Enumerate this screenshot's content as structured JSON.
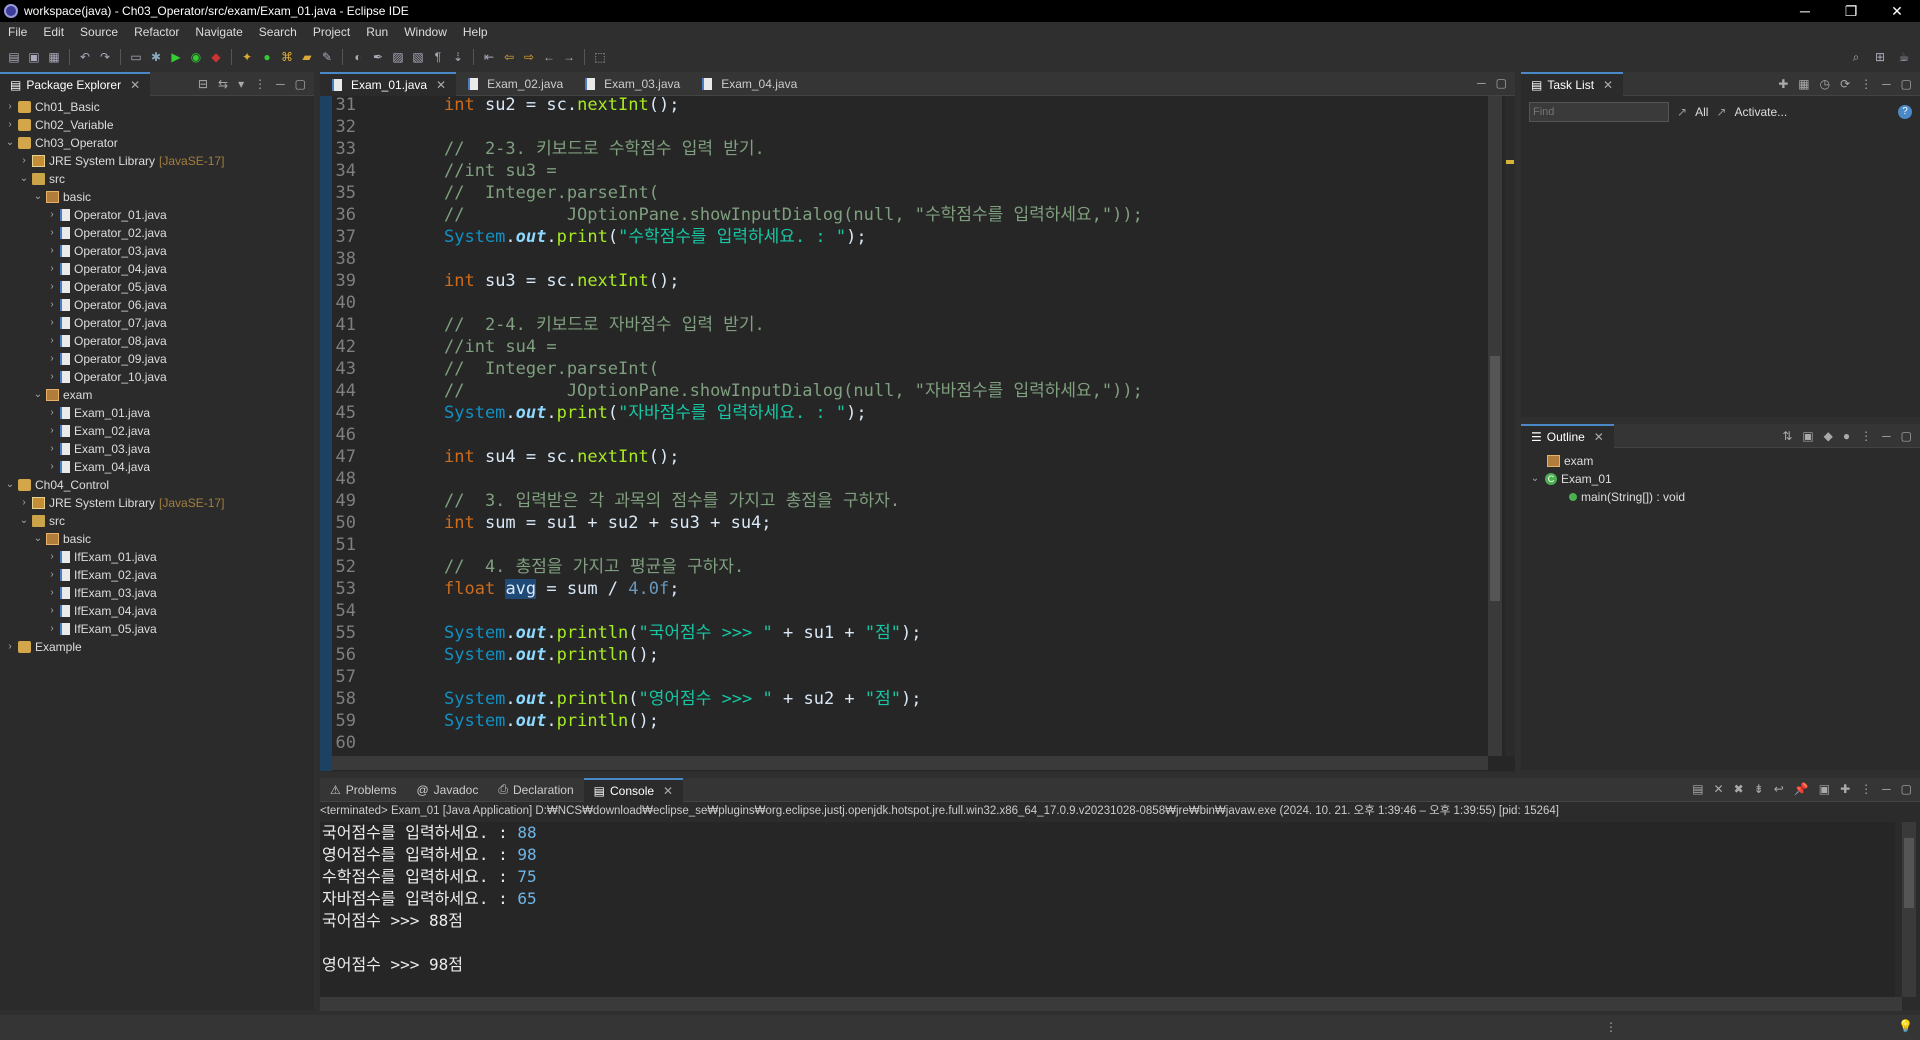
{
  "window": {
    "title": "workspace(java) - Ch03_Operator/src/exam/Exam_01.java - Eclipse IDE"
  },
  "menu": [
    "File",
    "Edit",
    "Source",
    "Refactor",
    "Navigate",
    "Search",
    "Project",
    "Run",
    "Window",
    "Help"
  ],
  "package_explorer": {
    "title": "Package Explorer",
    "items": [
      {
        "label": "Ch01_Basic",
        "type": "proj",
        "level": 0,
        "open": false
      },
      {
        "label": "Ch02_Variable",
        "type": "proj",
        "level": 0,
        "open": false
      },
      {
        "label": "Ch03_Operator",
        "type": "proj",
        "level": 0,
        "open": true
      },
      {
        "label": "JRE System Library",
        "extra": "[JavaSE-17]",
        "type": "lib",
        "level": 1,
        "open": false
      },
      {
        "label": "src",
        "type": "src",
        "level": 1,
        "open": true
      },
      {
        "label": "basic",
        "type": "pkg",
        "level": 2,
        "open": true
      },
      {
        "label": "Operator_01.java",
        "type": "java",
        "level": 3,
        "open": false
      },
      {
        "label": "Operator_02.java",
        "type": "java",
        "level": 3,
        "open": false
      },
      {
        "label": "Operator_03.java",
        "type": "java",
        "level": 3,
        "open": false
      },
      {
        "label": "Operator_04.java",
        "type": "java",
        "level": 3,
        "open": false
      },
      {
        "label": "Operator_05.java",
        "type": "java",
        "level": 3,
        "open": false
      },
      {
        "label": "Operator_06.java",
        "type": "java",
        "level": 3,
        "open": false
      },
      {
        "label": "Operator_07.java",
        "type": "java",
        "level": 3,
        "open": false
      },
      {
        "label": "Operator_08.java",
        "type": "java",
        "level": 3,
        "open": false
      },
      {
        "label": "Operator_09.java",
        "type": "java",
        "level": 3,
        "open": false
      },
      {
        "label": "Operator_10.java",
        "type": "java",
        "level": 3,
        "open": false
      },
      {
        "label": "exam",
        "type": "pkg",
        "level": 2,
        "open": true
      },
      {
        "label": "Exam_01.java",
        "type": "java",
        "level": 3,
        "open": false
      },
      {
        "label": "Exam_02.java",
        "type": "java",
        "level": 3,
        "open": false
      },
      {
        "label": "Exam_03.java",
        "type": "java",
        "level": 3,
        "open": false
      },
      {
        "label": "Exam_04.java",
        "type": "java",
        "level": 3,
        "open": false
      },
      {
        "label": "Ch04_Control",
        "type": "proj",
        "level": 0,
        "open": true
      },
      {
        "label": "JRE System Library",
        "extra": "[JavaSE-17]",
        "type": "lib",
        "level": 1,
        "open": false
      },
      {
        "label": "src",
        "type": "src",
        "level": 1,
        "open": true
      },
      {
        "label": "basic",
        "type": "pkg",
        "level": 2,
        "open": true
      },
      {
        "label": "IfExam_01.java",
        "type": "java",
        "level": 3,
        "open": false
      },
      {
        "label": "IfExam_02.java",
        "type": "java",
        "level": 3,
        "open": false
      },
      {
        "label": "IfExam_03.java",
        "type": "java",
        "level": 3,
        "open": false
      },
      {
        "label": "IfExam_04.java",
        "type": "java",
        "level": 3,
        "open": false
      },
      {
        "label": "IfExam_05.java",
        "type": "java",
        "level": 3,
        "open": false
      },
      {
        "label": "Example",
        "type": "proj",
        "level": 0,
        "open": false
      }
    ]
  },
  "editor": {
    "tabs": [
      "Exam_01.java",
      "Exam_02.java",
      "Exam_03.java",
      "Exam_04.java"
    ],
    "lines": [
      {
        "n": "31",
        "html": "<span class='kw'>int</span> su2 = sc.<span class='mth'>nextInt</span>();"
      },
      {
        "n": "32",
        "html": ""
      },
      {
        "n": "33",
        "html": "<span class='cm'>//  2-3. 키보드로 수학점수 입력 받기.</span>"
      },
      {
        "n": "34",
        "html": "<span class='cm'>//int su3 =</span>"
      },
      {
        "n": "35",
        "html": "<span class='cm'>//  Integer.parseInt(</span>"
      },
      {
        "n": "36",
        "html": "<span class='cm'>//          JOptionPane.showInputDialog(null, \"수학점수를 입력하세요,\"));</span>"
      },
      {
        "n": "37",
        "html": "<span class='cls'>System</span>.<span class='it'>out</span>.<span class='mth'>print</span>(<span class='str'>\"수학점수를 입력하세요. : \"</span>);"
      },
      {
        "n": "38",
        "html": ""
      },
      {
        "n": "39",
        "html": "<span class='kw'>int</span> su3 = sc.<span class='mth'>nextInt</span>();"
      },
      {
        "n": "40",
        "html": ""
      },
      {
        "n": "41",
        "html": "<span class='cm'>//  2-4. 키보드로 자바점수 입력 받기.</span>"
      },
      {
        "n": "42",
        "html": "<span class='cm'>//int su4 =</span>"
      },
      {
        "n": "43",
        "html": "<span class='cm'>//  Integer.parseInt(</span>"
      },
      {
        "n": "44",
        "html": "<span class='cm'>//          JOptionPane.showInputDialog(null, \"자바점수를 입력하세요,\"));</span>"
      },
      {
        "n": "45",
        "html": "<span class='cls'>System</span>.<span class='it'>out</span>.<span class='mth'>print</span>(<span class='str'>\"자바점수를 입력하세요. : \"</span>);"
      },
      {
        "n": "46",
        "html": ""
      },
      {
        "n": "47",
        "html": "<span class='kw'>int</span> su4 = sc.<span class='mth'>nextInt</span>();"
      },
      {
        "n": "48",
        "html": ""
      },
      {
        "n": "49",
        "html": "<span class='cm'>//  3. 입력받은 각 과목의 점수를 가지고 총점을 구하자.</span>"
      },
      {
        "n": "50",
        "html": "<span class='kw'>int</span> sum = su1 + su2 + su3 + su4;"
      },
      {
        "n": "51",
        "html": ""
      },
      {
        "n": "52",
        "html": "<span class='cm'>//  4. 총점을 가지고 평균을 구하자.</span>"
      },
      {
        "n": "53",
        "html": "<span class='kw'>float</span> <span class='hl'>avg</span> = sum / <span class='num'>4.0f</span>;"
      },
      {
        "n": "54",
        "html": ""
      },
      {
        "n": "55",
        "html": "<span class='cls'>System</span>.<span class='it'>out</span>.<span class='mth'>println</span>(<span class='str'>\"국어점수 >>> \"</span> + su1 + <span class='str'>\"점\"</span>);"
      },
      {
        "n": "56",
        "html": "<span class='cls'>System</span>.<span class='it'>out</span>.<span class='mth'>println</span>();"
      },
      {
        "n": "57",
        "html": ""
      },
      {
        "n": "58",
        "html": "<span class='cls'>System</span>.<span class='it'>out</span>.<span class='mth'>println</span>(<span class='str'>\"영어점수 >>> \"</span> + su2 + <span class='str'>\"점\"</span>);"
      },
      {
        "n": "59",
        "html": "<span class='cls'>System</span>.<span class='it'>out</span>.<span class='mth'>println</span>();"
      },
      {
        "n": "60",
        "html": ""
      }
    ]
  },
  "task_list": {
    "title": "Task List",
    "find_placeholder": "Find",
    "all_label": "All",
    "activate_label": "Activate..."
  },
  "outline": {
    "title": "Outline",
    "items": [
      "exam",
      "Exam_01",
      "main(String[]) : void"
    ]
  },
  "bottom": {
    "tabs": [
      "Problems",
      "Javadoc",
      "Declaration",
      "Console"
    ],
    "status": "<terminated> Exam_01 [Java Application] D:₩NCS₩download₩eclipse_se₩plugins₩org.eclipse.justj.openjdk.hotspot.jre.full.win32.x86_64_17.0.9.v20231028-0858₩jre₩bin₩javaw.exe  (2024. 10. 21. 오후 1:39:46 – 오후 1:39:55) [pid: 15264]",
    "output": [
      {
        "prompt": "국어점수를 입력하세요. : ",
        "input": "88"
      },
      {
        "prompt": "영어점수를 입력하세요. : ",
        "input": "98"
      },
      {
        "prompt": "수학점수를 입력하세요. : ",
        "input": "75"
      },
      {
        "prompt": "자바점수를 입력하세요. : ",
        "input": "65"
      },
      {
        "prompt": "국어점수 >>> 88점",
        "input": ""
      },
      {
        "prompt": "",
        "input": ""
      },
      {
        "prompt": "영어점수 >>> 98점",
        "input": ""
      }
    ]
  }
}
